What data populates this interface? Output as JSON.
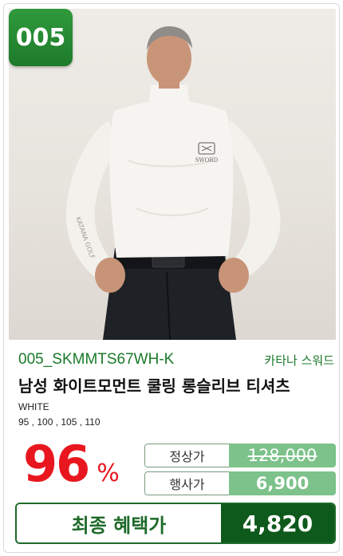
{
  "badge": {
    "number": "005",
    "color": "#1e7a2a"
  },
  "product": {
    "code": "005_SKMMTS67WH-K",
    "brand": "카타나 스워드",
    "title": "남성 화이트모먼트 쿨링 롱슬리브 티셔츠",
    "color": "WHITE",
    "sizes": "95 , 100 , 105 , 110",
    "image_logo_text": "SWORD",
    "sleeve_text": "KATANA GOLF"
  },
  "pricing": {
    "discount_number": "96",
    "discount_unit": "%",
    "normal_label": "정상가",
    "normal_price": "128,000",
    "sale_label": "행사가",
    "sale_price": "6,900",
    "final_label": "최종 혜택가",
    "final_price": "4,820",
    "accent_red": "#e8171f",
    "accent_green": "#0e5a1c"
  }
}
